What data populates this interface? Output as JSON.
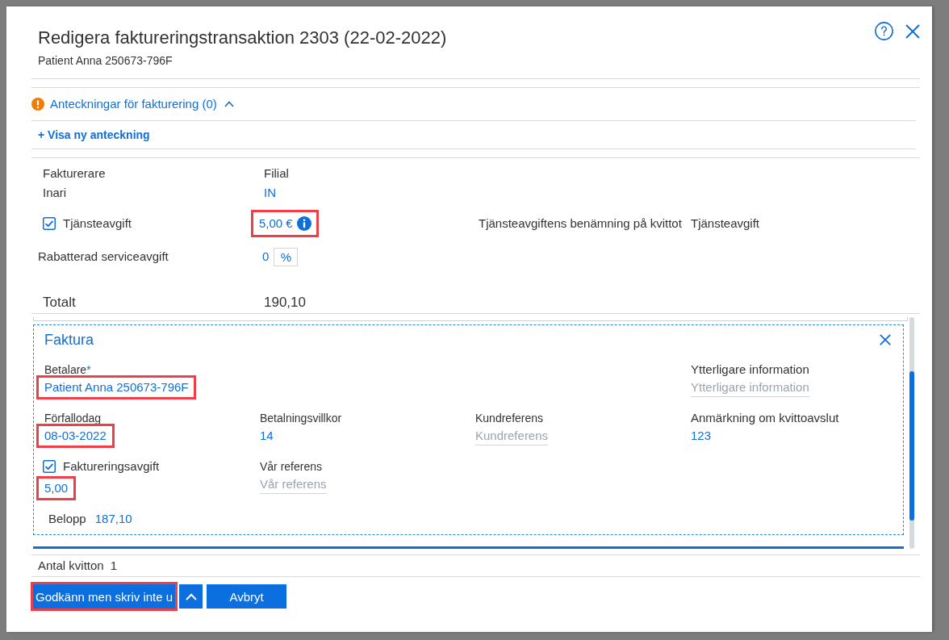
{
  "dialog": {
    "title": "Redigera faktureringstransaktion 2303 (22-02-2022)",
    "subtitle": "Patient Anna 250673-796F"
  },
  "notes": {
    "label": "Anteckningar för fakturering (0)",
    "expanded": true,
    "add_link": "+ Visa ny anteckning"
  },
  "billing": {
    "biller": {
      "label": "Fakturerare",
      "value": "Inari"
    },
    "branch": {
      "label": "Filial",
      "value": "IN"
    },
    "service_fee": {
      "label": "Tjänsteavgift",
      "checked": true,
      "value": "5,00 €",
      "highlighted": true
    },
    "receipt_name": {
      "label": "Tjänsteavgiftens benämning på kvittot",
      "value": "Tjänsteavgift"
    },
    "discount": {
      "label": "Rabatterad serviceavgift",
      "value": "0",
      "unit": "%"
    },
    "total": {
      "label": "Totalt",
      "value": "190,10"
    }
  },
  "invoice": {
    "title": "Faktura",
    "rows": [
      [
        {
          "kind": "text",
          "label": "Betalare",
          "required_mark": "*",
          "value": "Patient Anna 250673-796F",
          "highlighted": true
        },
        null,
        null,
        {
          "kind": "input",
          "label": "Ytterligare information",
          "placeholder": "Ytterligare information",
          "highlighted": false
        }
      ],
      [
        {
          "kind": "text",
          "label": "Förfallodag",
          "value": "08-03-2022",
          "highlighted": true
        },
        {
          "kind": "text",
          "label": "Betalningsvillkor",
          "value": "14",
          "highlighted": false
        },
        {
          "kind": "input",
          "label": "Kundreferens",
          "placeholder": "Kundreferens",
          "highlighted": false
        },
        {
          "kind": "text",
          "label": "Anmärkning om kvittoavslut",
          "value": "123",
          "highlighted": false
        }
      ],
      [
        {
          "kind": "checkbox",
          "label": "Faktureringsavgift",
          "checked": true,
          "value": "5,00",
          "highlighted": true
        },
        {
          "kind": "input",
          "label": "Vår referens",
          "placeholder": "Vår referens",
          "highlighted": false
        }
      ]
    ],
    "amount": {
      "label": "Belopp",
      "value": "187,10"
    }
  },
  "footer": {
    "receipt_count": {
      "label": "Antal kvitton",
      "value": "1"
    },
    "buttons": [
      {
        "kind": "primary",
        "label": "Godkänn men skriv inte u",
        "highlighted": true
      },
      {
        "kind": "caret",
        "highlighted": false
      },
      {
        "kind": "primary",
        "label": "Avbryt",
        "highlighted": false
      }
    ]
  }
}
